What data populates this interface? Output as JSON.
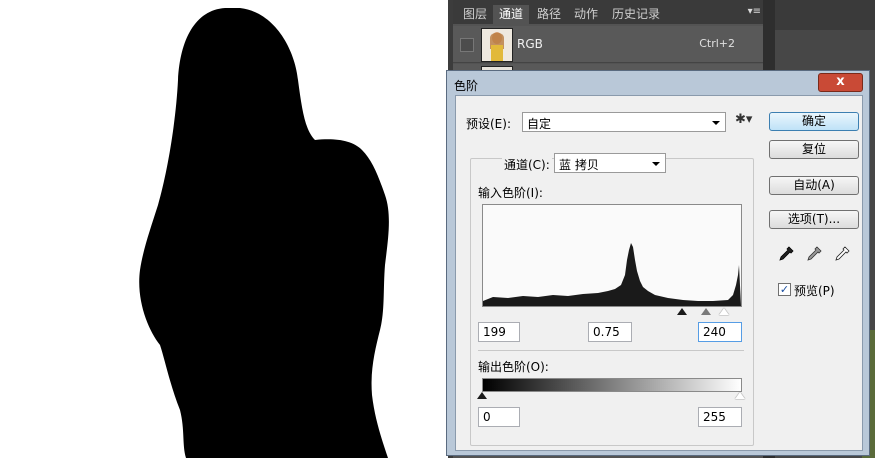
{
  "panel": {
    "tabs": [
      "图层",
      "通道",
      "路径",
      "动作",
      "历史记录"
    ],
    "active_tab": "通道",
    "channels": [
      {
        "name": "RGB",
        "shortcut": "Ctrl+2"
      }
    ]
  },
  "dialog": {
    "title": "色阶",
    "close_label": "x",
    "preset_label": "预设(E):",
    "preset_value": "自定",
    "channel_label": "通道(C):",
    "channel_value": "蓝 拷贝",
    "input_levels_label": "输入色阶(I):",
    "input_black": "199",
    "input_gamma": "0.75",
    "input_white": "240",
    "output_levels_label": "输出色阶(O):",
    "output_black": "0",
    "output_white": "255",
    "buttons": {
      "ok": "确定",
      "reset": "复位",
      "auto": "自动(A)",
      "options": "选项(T)..."
    },
    "preview_label": "预览(P)",
    "preview_checked": true
  }
}
